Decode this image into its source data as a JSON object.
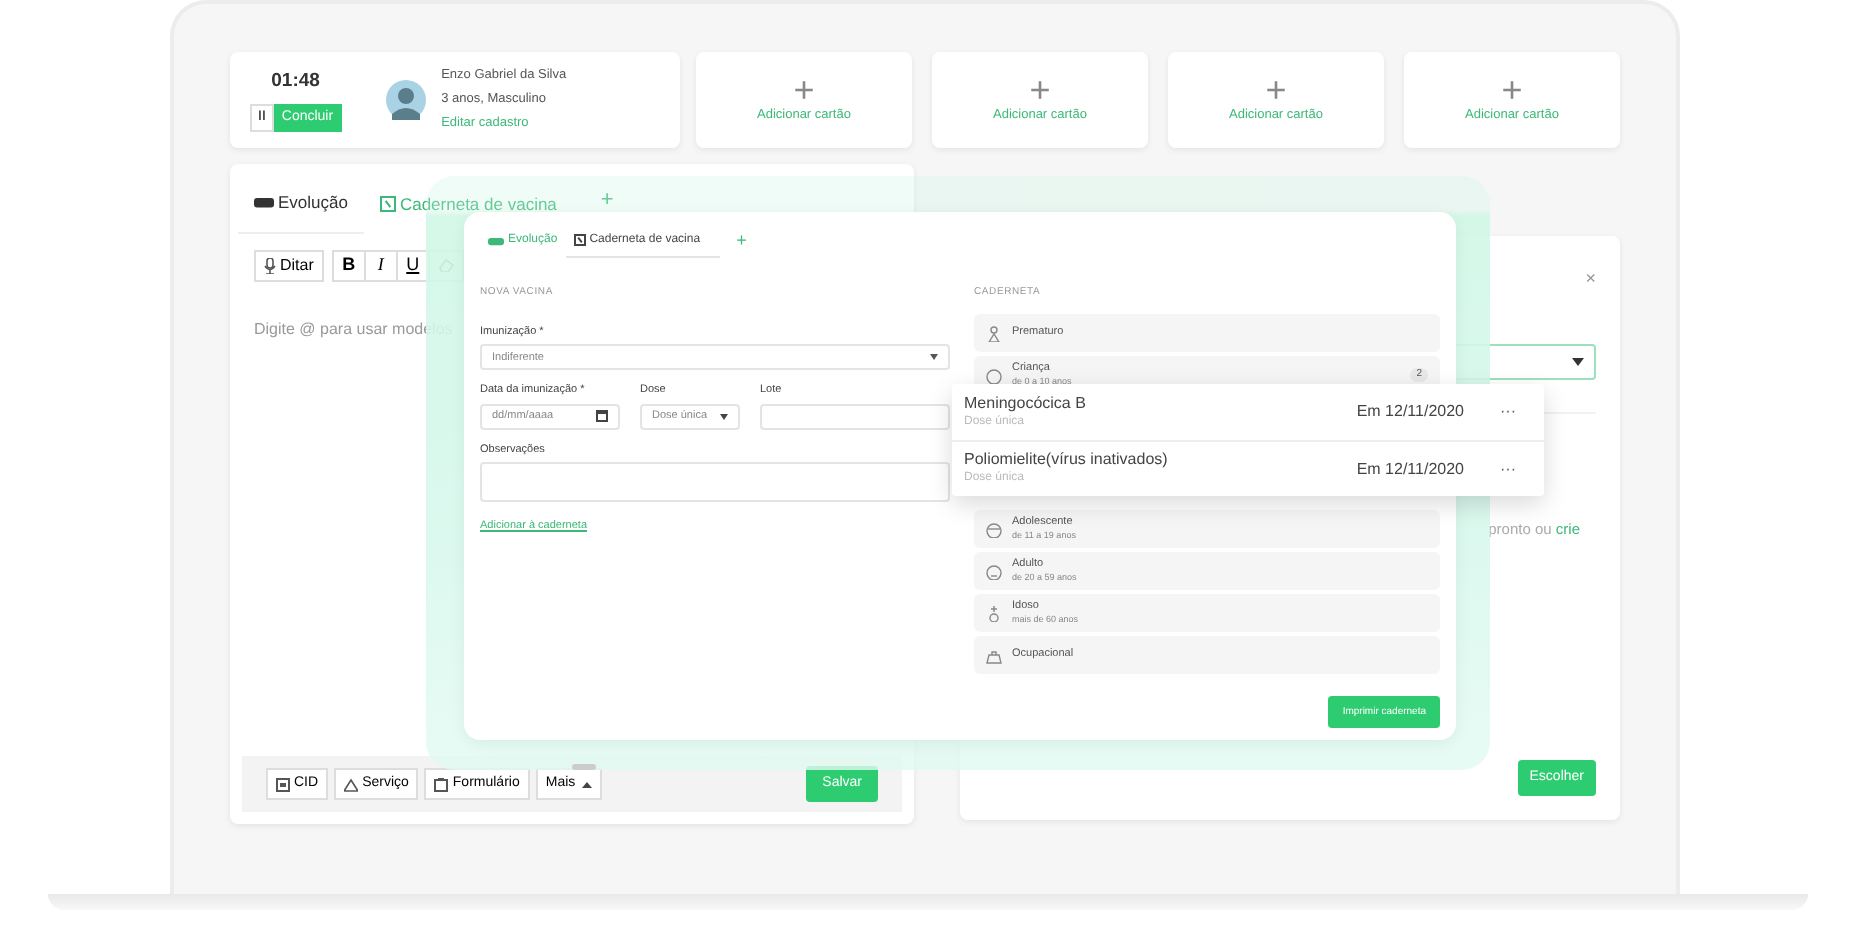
{
  "timer": {
    "time": "01:48",
    "pause": "II",
    "finish": "Concluir"
  },
  "patient": {
    "name": "Enzo Gabriel da Silva",
    "details": "3 anos, Masculino",
    "edit_link": "Editar cadastro"
  },
  "add_cards": [
    {
      "plus": "+",
      "label": "Adicionar cartão"
    },
    {
      "plus": "+",
      "label": "Adicionar cartão"
    },
    {
      "plus": "+",
      "label": "Adicionar cartão"
    },
    {
      "plus": "+",
      "label": "Adicionar cartão"
    }
  ],
  "editor": {
    "tabs": [
      {
        "label": "Evolução",
        "kind": "note",
        "selected": true
      },
      {
        "label": "Caderneta de vacina",
        "kind": "vaccine",
        "selected": false
      }
    ],
    "add_tab": "+",
    "toolbar": [
      {
        "kind": "dictate",
        "label": "Ditar"
      },
      {
        "kind": "bold",
        "label": "B"
      },
      {
        "kind": "italic",
        "label": "I"
      },
      {
        "kind": "underline",
        "label": "U"
      },
      {
        "kind": "eraser"
      }
    ],
    "placeholder": "Digite @ para usar modelos",
    "footer_buttons": [
      {
        "kind": "cid",
        "label": "CID"
      },
      {
        "kind": "service",
        "label": "Serviço"
      },
      {
        "kind": "form",
        "label": "Formulário"
      },
      {
        "kind": "more",
        "label": "Mais"
      }
    ],
    "save": "Salvar"
  },
  "side_panel": {
    "close": "×",
    "hint": "pronto ou",
    "hint_link": "crie",
    "choose": "Escolher"
  },
  "modal": {
    "tabs": [
      {
        "label": "Evolução",
        "kind": "note",
        "selected": false
      },
      {
        "label": "Caderneta de vacina",
        "kind": "vaccine",
        "selected": true
      }
    ],
    "add_tab": "+",
    "section": "NOVA VACINA",
    "immunization": {
      "label": "Imunização *",
      "value": "Indiferente"
    },
    "date": {
      "label": "Data da imunização *",
      "placeholder": "dd/mm/aaaa"
    },
    "dose": {
      "label": "Dose",
      "value": "Dose única"
    },
    "lot": {
      "label": "Lote"
    },
    "notes": {
      "label": "Observações"
    },
    "add_link": "Adicionar à caderneta",
    "booklet_title": "CADERNETA",
    "groups": [
      {
        "kind": "baby",
        "name": "Prematuro"
      },
      {
        "kind": "child",
        "name": "Criança",
        "range": "de 0 a 10 anos",
        "count": "2"
      },
      {
        "kind": "teen",
        "name": "Adolescente",
        "range": "de 11 a 19 anos"
      },
      {
        "kind": "adult",
        "name": "Adulto",
        "range": "de 20 a 59 anos"
      },
      {
        "kind": "senior",
        "name": "Idoso",
        "range": "mais de 60 anos"
      },
      {
        "kind": "work",
        "name": "Ocupacional"
      }
    ],
    "print": "Imprimir caderneta"
  },
  "vaccine_popup": [
    {
      "name": "Meningocócica B",
      "dose": "Dose única",
      "date": "Em 12/11/2020",
      "menu": "···"
    },
    {
      "name": "Poliomielite(vírus inativados)",
      "dose": "Dose única",
      "date": "Em 12/11/2020",
      "menu": "···"
    }
  ]
}
